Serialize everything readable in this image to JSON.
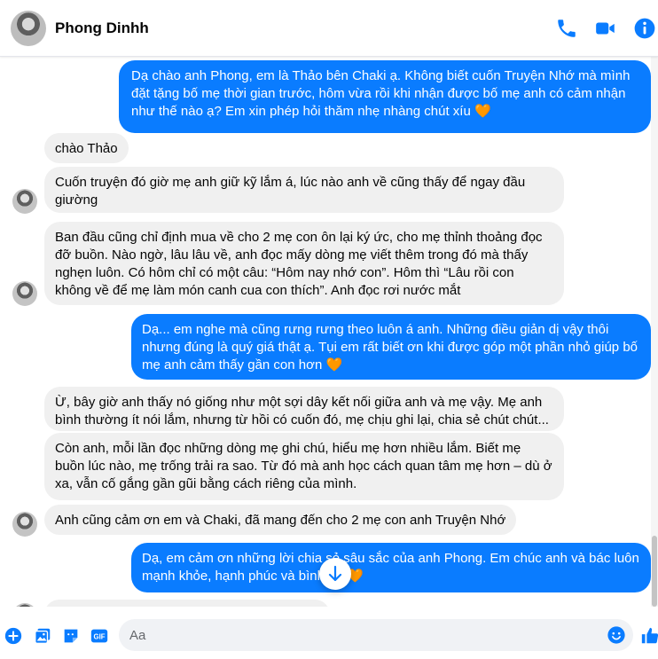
{
  "header": {
    "contact_name": "Phong Dinhh",
    "icons": [
      "phone-icon",
      "video-camera-icon",
      "info-icon"
    ]
  },
  "messages": [
    {
      "side": "out",
      "text": "Dạ chào anh Phong, em là Thảo bên Chaki ạ. Không biết cuốn Truyện Nhớ mà mình đặt tặng bố mẹ thời gian trước, hôm vừa rồi khi nhận được bố mẹ anh có cảm nhận như thế nào ạ? Em xin phép hỏi thăm nhẹ nhàng chút xíu 🧡"
    },
    {
      "side": "in",
      "text": "chào Thảo"
    },
    {
      "side": "in",
      "text": "Cuốn truyện đó giờ mẹ anh giữ kỹ lắm á, lúc nào anh về cũng thấy để ngay đầu giường"
    },
    {
      "side": "in",
      "text": "Ban đầu cũng chỉ định mua về cho 2 mẹ con ôn lại ký ức, cho mẹ thỉnh thoảng đọc đỡ buồn. Nào ngờ, lâu lâu về, anh đọc mấy dòng mẹ viết thêm trong đó mà thấy nghẹn luôn. Có hôm chỉ có một câu: “Hôm nay nhớ con”. Hôm thì “Lâu rồi con không về để mẹ làm món canh cua con thích”. Anh đọc rơi nước mắt"
    },
    {
      "side": "out",
      "text": "Dạ... em nghe mà cũng rưng rưng theo luôn á anh. Những điều giản dị vậy thôi nhưng đúng là quý giá thật ạ. Tụi em rất biết ơn khi được góp một phần nhỏ giúp bố mẹ anh cảm thấy gần con hơn 🧡"
    },
    {
      "side": "in",
      "text": "Ừ, bây giờ anh thấy nó giống như một sợi dây kết nối giữa anh và mẹ vậy. Mẹ anh bình thường ít nói lắm, nhưng từ hồi có cuốn đó, mẹ chịu ghi lại, chia sẻ chút chút..."
    },
    {
      "side": "in",
      "text": "Còn anh, mỗi lần đọc những dòng mẹ ghi chú, hiểu mẹ hơn nhiều lắm. Biết mẹ buồn lúc nào, mẹ trống trải ra sao. Từ đó mà anh học cách quan tâm mẹ hơn – dù ở xa, vẫn cố gắng gần gũi bằng cách riêng của mình."
    },
    {
      "side": "in",
      "text": "Anh cũng cảm ơn em và Chaki, đã mang đến cho 2 mẹ con anh Truyện Nhớ"
    },
    {
      "side": "out",
      "text": "Dạ, em cảm ơn những lời chia sẻ sâu sắc của anh Phong. Em chúc anh và bác luôn mạnh khỏe, hạnh phúc và bình an 🧡"
    }
  ],
  "composer": {
    "placeholder": "Aa",
    "icons": [
      "plus-icon",
      "image-icon",
      "sticker-icon",
      "gif-icon",
      "emoji-icon",
      "like-icon"
    ]
  },
  "colors": {
    "accent": "#0a7cff",
    "incoming_bubble": "#f0f0f0",
    "heart": "#f7931e"
  }
}
